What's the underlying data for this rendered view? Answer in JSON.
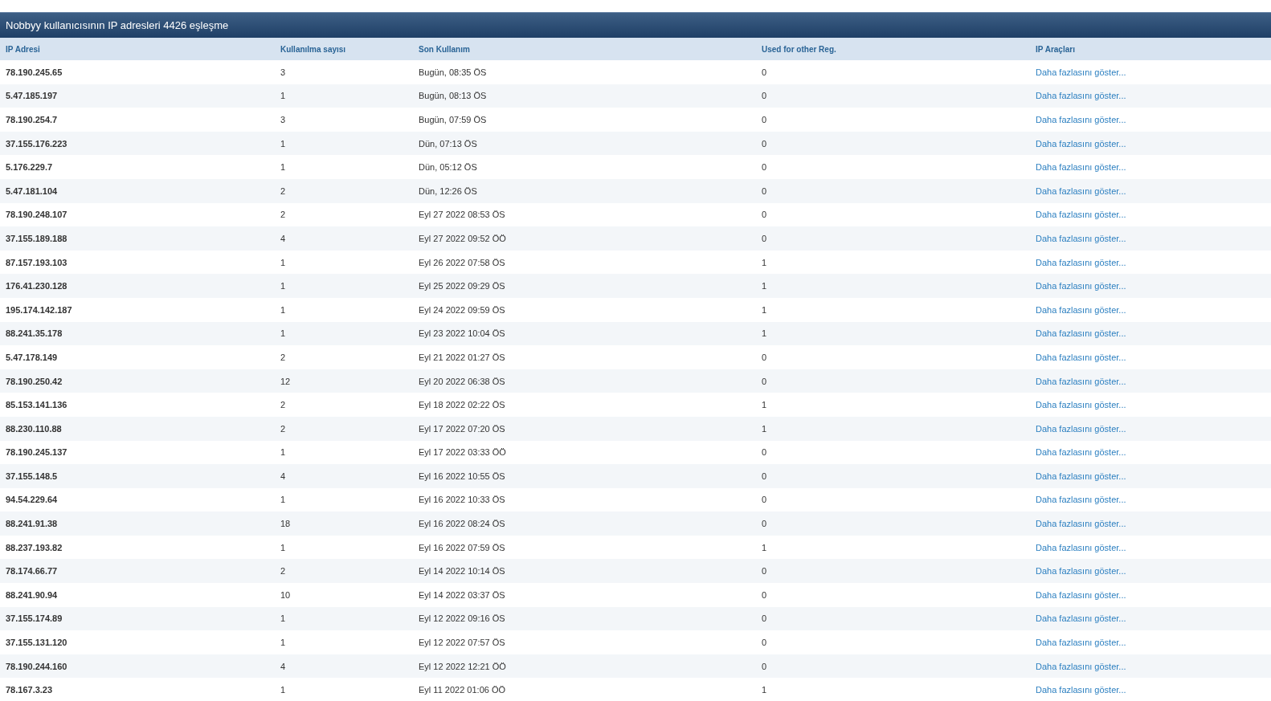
{
  "title": "Nobbyy kullanıcısının IP adresleri 4426 eşleşme",
  "columns": [
    "IP Adresi",
    "Kullanılma sayısı",
    "Son Kullanım",
    "Used for other Reg.",
    "IP Araçları"
  ],
  "rows": [
    {
      "ip": "78.190.245.65",
      "count": "3",
      "last_used": "Bugün, 08:35 ÖS",
      "other_reg": "0",
      "link": "Daha fazlasını göster..."
    },
    {
      "ip": "5.47.185.197",
      "count": "1",
      "last_used": "Bugün, 08:13 ÖS",
      "other_reg": "0",
      "link": "Daha fazlasını göster..."
    },
    {
      "ip": "78.190.254.7",
      "count": "3",
      "last_used": "Bugün, 07:59 ÖS",
      "other_reg": "0",
      "link": "Daha fazlasını göster..."
    },
    {
      "ip": "37.155.176.223",
      "count": "1",
      "last_used": "Dün, 07:13 ÖS",
      "other_reg": "0",
      "link": "Daha fazlasını göster..."
    },
    {
      "ip": "5.176.229.7",
      "count": "1",
      "last_used": "Dün, 05:12 ÖS",
      "other_reg": "0",
      "link": "Daha fazlasını göster..."
    },
    {
      "ip": "5.47.181.104",
      "count": "2",
      "last_used": "Dün, 12:26 ÖS",
      "other_reg": "0",
      "link": "Daha fazlasını göster..."
    },
    {
      "ip": "78.190.248.107",
      "count": "2",
      "last_used": "Eyl 27 2022 08:53 ÖS",
      "other_reg": "0",
      "link": "Daha fazlasını göster..."
    },
    {
      "ip": "37.155.189.188",
      "count": "4",
      "last_used": "Eyl 27 2022 09:52 ÖÖ",
      "other_reg": "0",
      "link": "Daha fazlasını göster..."
    },
    {
      "ip": "87.157.193.103",
      "count": "1",
      "last_used": "Eyl 26 2022 07:58 ÖS",
      "other_reg": "1",
      "link": "Daha fazlasını göster..."
    },
    {
      "ip": "176.41.230.128",
      "count": "1",
      "last_used": "Eyl 25 2022 09:29 ÖS",
      "other_reg": "1",
      "link": "Daha fazlasını göster..."
    },
    {
      "ip": "195.174.142.187",
      "count": "1",
      "last_used": "Eyl 24 2022 09:59 ÖS",
      "other_reg": "1",
      "link": "Daha fazlasını göster..."
    },
    {
      "ip": "88.241.35.178",
      "count": "1",
      "last_used": "Eyl 23 2022 10:04 ÖS",
      "other_reg": "1",
      "link": "Daha fazlasını göster..."
    },
    {
      "ip": "5.47.178.149",
      "count": "2",
      "last_used": "Eyl 21 2022 01:27 ÖS",
      "other_reg": "0",
      "link": "Daha fazlasını göster..."
    },
    {
      "ip": "78.190.250.42",
      "count": "12",
      "last_used": "Eyl 20 2022 06:38 ÖS",
      "other_reg": "0",
      "link": "Daha fazlasını göster..."
    },
    {
      "ip": "85.153.141.136",
      "count": "2",
      "last_used": "Eyl 18 2022 02:22 ÖS",
      "other_reg": "1",
      "link": "Daha fazlasını göster..."
    },
    {
      "ip": "88.230.110.88",
      "count": "2",
      "last_used": "Eyl 17 2022 07:20 ÖS",
      "other_reg": "1",
      "link": "Daha fazlasını göster..."
    },
    {
      "ip": "78.190.245.137",
      "count": "1",
      "last_used": "Eyl 17 2022 03:33 ÖÖ",
      "other_reg": "0",
      "link": "Daha fazlasını göster..."
    },
    {
      "ip": "37.155.148.5",
      "count": "4",
      "last_used": "Eyl 16 2022 10:55 ÖS",
      "other_reg": "0",
      "link": "Daha fazlasını göster..."
    },
    {
      "ip": "94.54.229.64",
      "count": "1",
      "last_used": "Eyl 16 2022 10:33 ÖS",
      "other_reg": "0",
      "link": "Daha fazlasını göster..."
    },
    {
      "ip": "88.241.91.38",
      "count": "18",
      "last_used": "Eyl 16 2022 08:24 ÖS",
      "other_reg": "0",
      "link": "Daha fazlasını göster..."
    },
    {
      "ip": "88.237.193.82",
      "count": "1",
      "last_used": "Eyl 16 2022 07:59 ÖS",
      "other_reg": "1",
      "link": "Daha fazlasını göster..."
    },
    {
      "ip": "78.174.66.77",
      "count": "2",
      "last_used": "Eyl 14 2022 10:14 ÖS",
      "other_reg": "0",
      "link": "Daha fazlasını göster..."
    },
    {
      "ip": "88.241.90.94",
      "count": "10",
      "last_used": "Eyl 14 2022 03:37 ÖS",
      "other_reg": "0",
      "link": "Daha fazlasını göster..."
    },
    {
      "ip": "37.155.174.89",
      "count": "1",
      "last_used": "Eyl 12 2022 09:16 ÖS",
      "other_reg": "0",
      "link": "Daha fazlasını göster..."
    },
    {
      "ip": "37.155.131.120",
      "count": "1",
      "last_used": "Eyl 12 2022 07:57 ÖS",
      "other_reg": "0",
      "link": "Daha fazlasını göster..."
    },
    {
      "ip": "78.190.244.160",
      "count": "4",
      "last_used": "Eyl 12 2022 12:21 ÖÖ",
      "other_reg": "0",
      "link": "Daha fazlasını göster..."
    },
    {
      "ip": "78.167.3.23",
      "count": "1",
      "last_used": "Eyl 11 2022 01:06 ÖÖ",
      "other_reg": "1",
      "link": "Daha fazlasını göster..."
    }
  ]
}
